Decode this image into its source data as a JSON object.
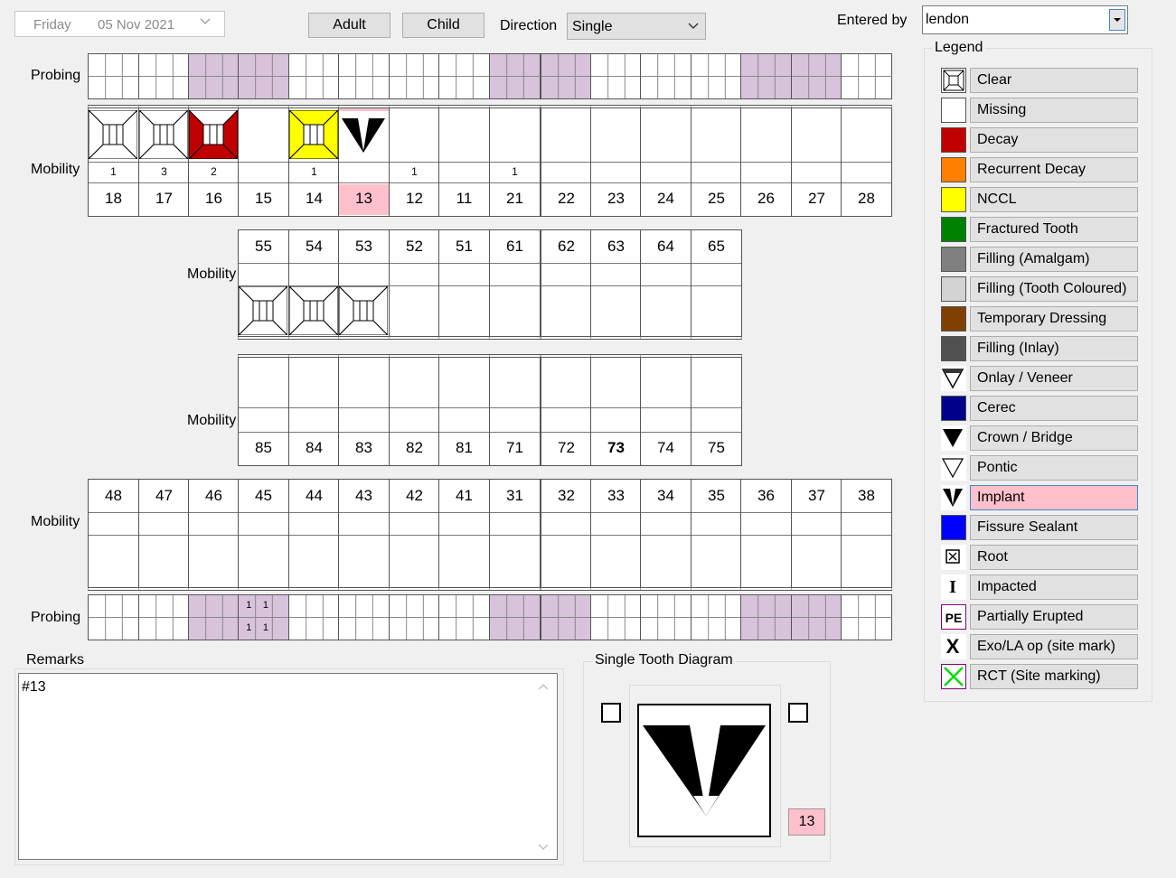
{
  "header": {
    "date_day": "Friday",
    "date_value": "05 Nov  2021",
    "adult_label": "Adult",
    "child_label": "Child",
    "direction_label": "Direction",
    "direction_value": "Single",
    "entered_by_label": "Entered by",
    "entered_by_value": "lendon"
  },
  "labels": {
    "probing": "Probing",
    "mobility": "Mobility"
  },
  "upper_adult": {
    "teeth": [
      "18",
      "17",
      "16",
      "15",
      "14",
      "13",
      "12",
      "11",
      "21",
      "22",
      "23",
      "24",
      "25",
      "26",
      "27",
      "28"
    ],
    "mobility": [
      "1",
      "3",
      "2",
      "",
      "1",
      "",
      "1",
      "",
      "1",
      "",
      "",
      "",
      "",
      "",
      "",
      ""
    ],
    "selected": "13"
  },
  "upper_child": {
    "teeth": [
      "55",
      "54",
      "53",
      "52",
      "51",
      "61",
      "62",
      "63",
      "64",
      "65"
    ]
  },
  "lower_child": {
    "teeth": [
      "85",
      "84",
      "83",
      "82",
      "81",
      "71",
      "72",
      "73",
      "74",
      "75"
    ],
    "bold": "73"
  },
  "lower_adult": {
    "teeth": [
      "48",
      "47",
      "46",
      "45",
      "44",
      "43",
      "42",
      "41",
      "31",
      "32",
      "33",
      "34",
      "35",
      "36",
      "37",
      "38"
    ]
  },
  "lower_probing_values": {
    "top": [
      "1",
      "1"
    ],
    "bottom": [
      "1",
      "1"
    ]
  },
  "remarks": {
    "title": "Remarks",
    "text": "#13"
  },
  "single_tooth": {
    "title": "Single Tooth Diagram",
    "tooth": "13"
  },
  "legend": {
    "title": "Legend",
    "items": [
      {
        "label": "Clear",
        "color": "#ffffff",
        "icon": "clear-icon"
      },
      {
        "label": "Missing",
        "color": "#ffffff",
        "icon": "missing-swatch"
      },
      {
        "label": "Decay",
        "color": "#c00000",
        "icon": "decay-swatch"
      },
      {
        "label": "Recurrent Decay",
        "color": "#ff7f00",
        "icon": "recurrent-decay-swatch"
      },
      {
        "label": "NCCL",
        "color": "#ffff00",
        "icon": "nccl-swatch"
      },
      {
        "label": "Fractured Tooth",
        "color": "#008000",
        "icon": "fractured-swatch"
      },
      {
        "label": "Filling (Amalgam)",
        "color": "#808080",
        "icon": "amalgam-swatch"
      },
      {
        "label": "Filling (Tooth Coloured)",
        "color": "#d3d3d3",
        "icon": "tooth-coloured-swatch"
      },
      {
        "label": "Temporary Dressing",
        "color": "#804000",
        "icon": "temp-dressing-swatch"
      },
      {
        "label": "Filling (Inlay)",
        "color": "#505050",
        "icon": "inlay-swatch"
      },
      {
        "label": "Onlay / Veneer",
        "color": "#ffffff",
        "icon": "onlay-icon"
      },
      {
        "label": "Cerec",
        "color": "#00008b",
        "icon": "cerec-swatch"
      },
      {
        "label": "Crown / Bridge",
        "color": "#ffffff",
        "icon": "crown-icon"
      },
      {
        "label": "Pontic",
        "color": "#ffffff",
        "icon": "pontic-icon"
      },
      {
        "label": "Implant",
        "color": "#ffffff",
        "icon": "implant-icon"
      },
      {
        "label": "Fissure Sealant",
        "color": "#0000ff",
        "icon": "fissure-swatch"
      },
      {
        "label": "Root",
        "color": "#ffffff",
        "icon": "root-icon"
      },
      {
        "label": "Impacted",
        "color": "#ffffff",
        "icon": "impacted-icon",
        "glyph": "I"
      },
      {
        "label": "Partially Erupted",
        "color": "#ffffff",
        "icon": "partially-erupted-icon",
        "glyph": "PE"
      },
      {
        "label": "Exo/LA op (site mark)",
        "color": "#ffffff",
        "icon": "exo-icon",
        "glyph": "X"
      },
      {
        "label": "RCT (Site marking)",
        "color": "#ffffff",
        "icon": "rct-icon"
      }
    ],
    "selected": "Implant"
  }
}
